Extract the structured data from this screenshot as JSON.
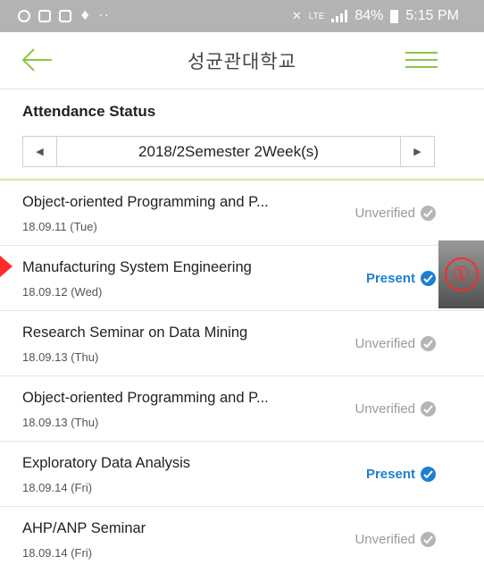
{
  "status_bar": {
    "dots": "··",
    "signal_text": "LTE",
    "battery": "84%",
    "time": "5:15 PM",
    "icons": [
      "sync-icon",
      "gallery-icon",
      "mail-icon",
      "notification-icon",
      "mute-icon",
      "signal-icon",
      "battery-icon"
    ]
  },
  "header": {
    "title": "성균관대학교",
    "accent_color": "#8cc63f"
  },
  "section": {
    "title": "Attendance Status"
  },
  "week_selector": {
    "label": "2018/2Semester 2Week(s)",
    "prev_icon": "◀",
    "next_icon": "▶"
  },
  "records": [
    {
      "course": "Object-oriented Programming and P...",
      "date": "18.09.11 (Tue)",
      "status": "Unverified"
    },
    {
      "course": "Manufacturing System Engineering",
      "date": "18.09.12 (Wed)",
      "status": "Present"
    },
    {
      "course": "Research Seminar on Data Mining",
      "date": "18.09.13 (Thu)",
      "status": "Unverified"
    },
    {
      "course": "Object-oriented Programming and P...",
      "date": "18.09.13 (Thu)",
      "status": "Unverified"
    },
    {
      "course": "Exploratory Data Analysis",
      "date": "18.09.14 (Fri)",
      "status": "Present"
    },
    {
      "course": "AHP/ANP Seminar",
      "date": "18.09.14 (Fri)",
      "status": "Unverified"
    }
  ],
  "annotation": {
    "callout_number": "①",
    "marker_color": "#ff2a2a"
  },
  "colors": {
    "present": "#1e7fd2",
    "unverified": "#9a9a9a"
  }
}
